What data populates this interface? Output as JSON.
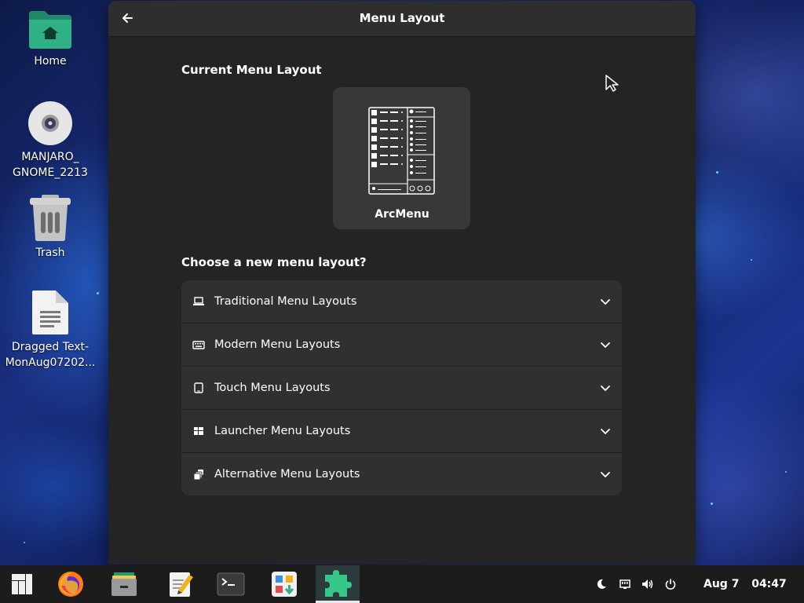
{
  "desktop": {
    "icons": [
      {
        "label": "Home",
        "icon": "home-folder-icon"
      },
      {
        "label": "MANJARO_\nGNOME_2213",
        "icon": "disc-icon"
      },
      {
        "label": "Trash",
        "icon": "trash-icon"
      },
      {
        "label": "Dragged Text-\nMonAug07202...",
        "icon": "text-file-icon"
      }
    ]
  },
  "window": {
    "title": "Menu Layout",
    "current_section": "Current Menu Layout",
    "current_layout_name": "ArcMenu",
    "choose_section": "Choose a new menu layout?",
    "categories": [
      {
        "label": "Traditional Menu Layouts",
        "icon": "laptop-icon"
      },
      {
        "label": "Modern Menu Layouts",
        "icon": "keyboard-icon"
      },
      {
        "label": "Touch Menu Layouts",
        "icon": "tablet-icon"
      },
      {
        "label": "Launcher Menu Layouts",
        "icon": "grid-icon"
      },
      {
        "label": "Alternative Menu Layouts",
        "icon": "stack-icon"
      }
    ]
  },
  "taskbar": {
    "apps": [
      "manjaro-logo-icon",
      "firefox-icon",
      "files-icon",
      "text-editor-icon",
      "terminal-icon",
      "software-center-icon",
      "extensions-icon"
    ],
    "tray": [
      "night-light-icon",
      "network-icon",
      "volume-icon",
      "power-icon"
    ],
    "date": "Aug 7",
    "time": "04:47"
  },
  "colors": {
    "accent": "#2ec27e",
    "window_bg": "#242424",
    "row_bg": "#303030"
  }
}
